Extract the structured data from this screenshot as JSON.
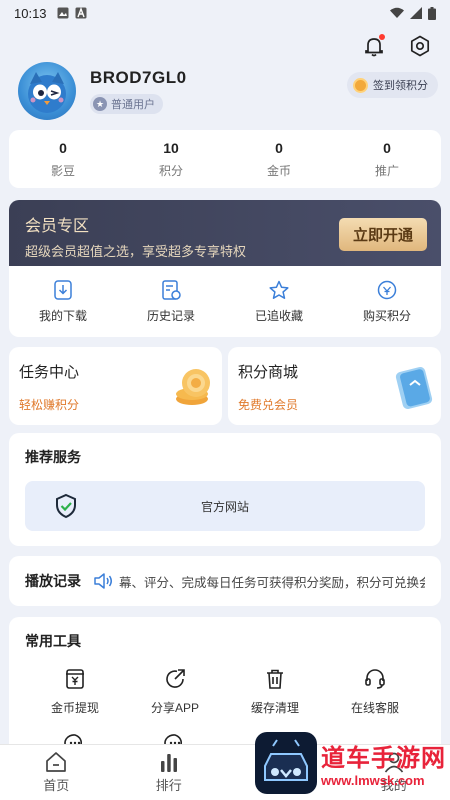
{
  "status": {
    "time": "10:13"
  },
  "user": {
    "name": "BROD7GL0",
    "level": "普通用户"
  },
  "signin": {
    "label": "签到领积分"
  },
  "stats": [
    {
      "value": "0",
      "label": "影豆"
    },
    {
      "value": "10",
      "label": "积分"
    },
    {
      "value": "0",
      "label": "金币"
    },
    {
      "value": "0",
      "label": "推广"
    }
  ],
  "vip": {
    "title": "会员专区",
    "subtitle": "超级会员超值之选，享受超多专享特权",
    "button": "立即开通",
    "items": [
      {
        "label": "我的下载",
        "icon": "download-icon"
      },
      {
        "label": "历史记录",
        "icon": "history-icon"
      },
      {
        "label": "已追收藏",
        "icon": "star-icon"
      },
      {
        "label": "购买积分",
        "icon": "points-icon"
      }
    ]
  },
  "tasks": [
    {
      "title": "任务中心",
      "subtitle": "轻松赚积分",
      "icon": "coin-stack-icon"
    },
    {
      "title": "积分商城",
      "subtitle": "免费兑会员",
      "icon": "card-icon"
    }
  ],
  "services": {
    "title": "推荐服务",
    "items": [
      {
        "label": "官方网站",
        "icon": "shield-check-icon"
      }
    ]
  },
  "play": {
    "title": "播放记录",
    "marquee": "幕、评分、完成每日任务可获得积分奖励，积分可兑换会"
  },
  "tools": {
    "title": "常用工具",
    "items": [
      {
        "label": "金币提现",
        "icon": "withdraw-icon"
      },
      {
        "label": "分享APP",
        "icon": "share-icon"
      },
      {
        "label": "缓存清理",
        "icon": "trash-icon"
      },
      {
        "label": "在线客服",
        "icon": "headset-icon"
      }
    ]
  },
  "tabs": [
    {
      "label": "首页",
      "icon": "home-icon"
    },
    {
      "label": "排行",
      "icon": "rank-icon"
    },
    {
      "label": "",
      "icon": "center-icon"
    },
    {
      "label": "我的",
      "icon": "profile-icon"
    }
  ],
  "watermark": {
    "cn": "道车手游网",
    "url": "www.lmwsk.com"
  },
  "colors": {
    "accent": "#e07a2c",
    "vip_bg": "#3b3f55",
    "vip_gold": "#e0b77d",
    "icon_blue": "#3b7fd9"
  }
}
